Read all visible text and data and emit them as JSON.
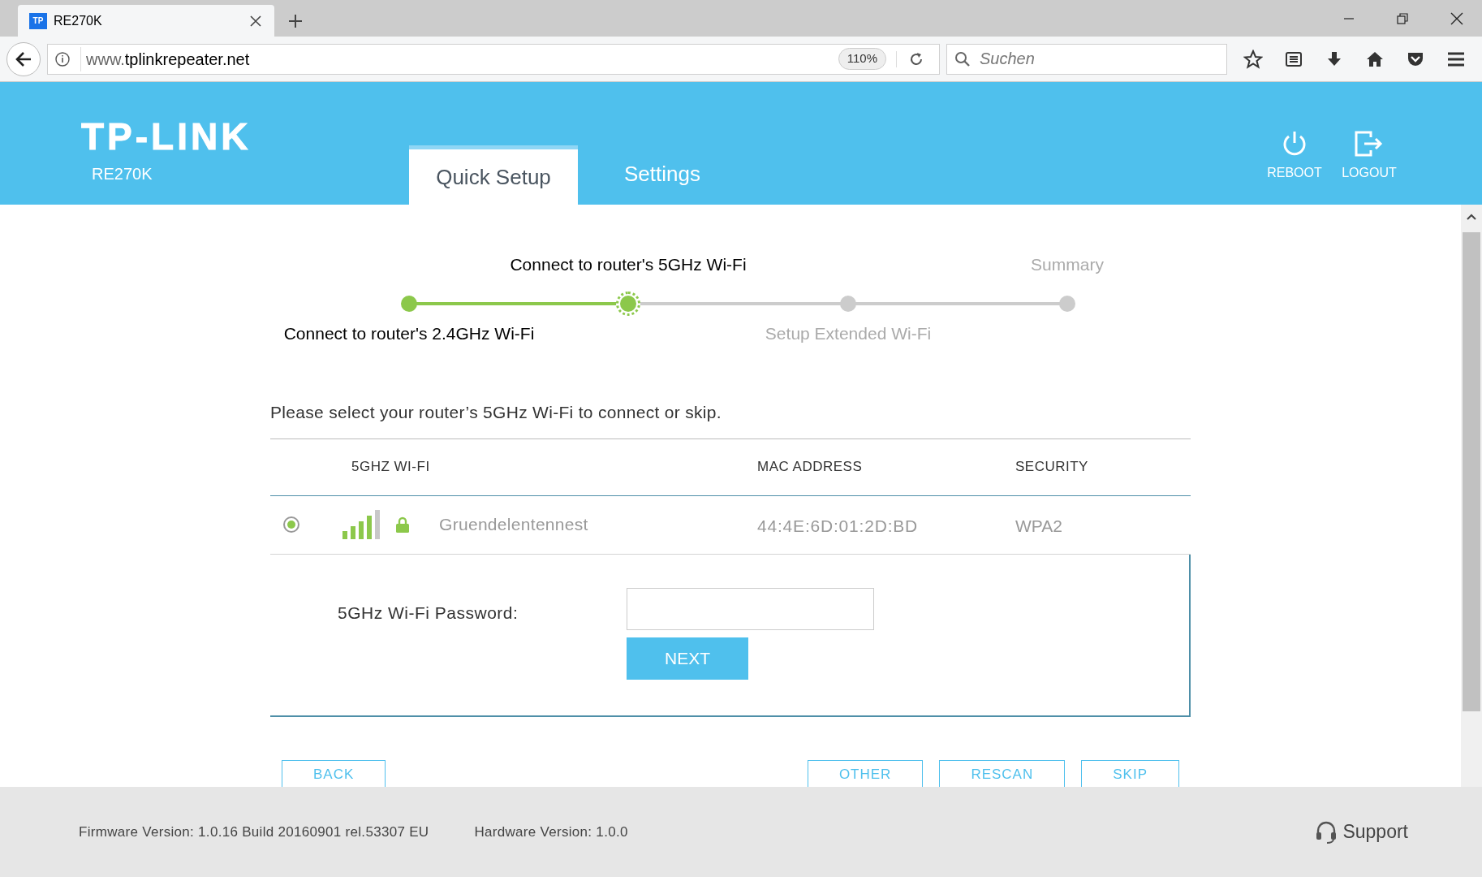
{
  "browser": {
    "tab_title": "RE270K",
    "tab_favicon": "TP",
    "url_prefix": "www.",
    "url_host": "tplinkrepeater.net",
    "zoom": "110%",
    "search_placeholder": "Suchen"
  },
  "header": {
    "logo": "TP-LINK",
    "model": "RE270K",
    "tabs": [
      {
        "label": "Quick Setup",
        "selected": true
      },
      {
        "label": "Settings",
        "selected": false
      }
    ],
    "actions": [
      {
        "kind": "reboot",
        "label": "REBOOT"
      },
      {
        "kind": "logout",
        "label": "LOGOUT"
      }
    ]
  },
  "steps": [
    {
      "label": "Connect to router's 2.4GHz Wi-Fi",
      "completed": true,
      "current": false
    },
    {
      "label": "Connect to router's 5GHz Wi-Fi",
      "completed": false,
      "current": true
    },
    {
      "label": "Setup Extended Wi-Fi",
      "completed": false,
      "current": false
    },
    {
      "label": "Summary",
      "completed": false,
      "current": false
    }
  ],
  "prompt": "Please select your router’s 5GHz Wi-Fi to connect or skip.",
  "table": {
    "columns": [
      "5GHZ WI-FI",
      "MAC ADDRESS",
      "SECURITY"
    ],
    "rows": [
      {
        "selected": true,
        "locked": true,
        "name": "Gruendelentennest",
        "mac": "44:4E:6D:01:2D:BD",
        "security": "WPA2"
      }
    ]
  },
  "password": {
    "label": "5GHz Wi-Fi Password:",
    "button": "NEXT"
  },
  "buttons_left": [
    "BACK"
  ],
  "buttons_right": [
    "OTHER",
    "RESCAN",
    "SKIP"
  ],
  "footer": {
    "firmware": "Firmware Version: 1.0.16 Build 20160901 rel.53307 EU",
    "hardware": "Hardware Version: 1.0.0",
    "support": "Support"
  }
}
